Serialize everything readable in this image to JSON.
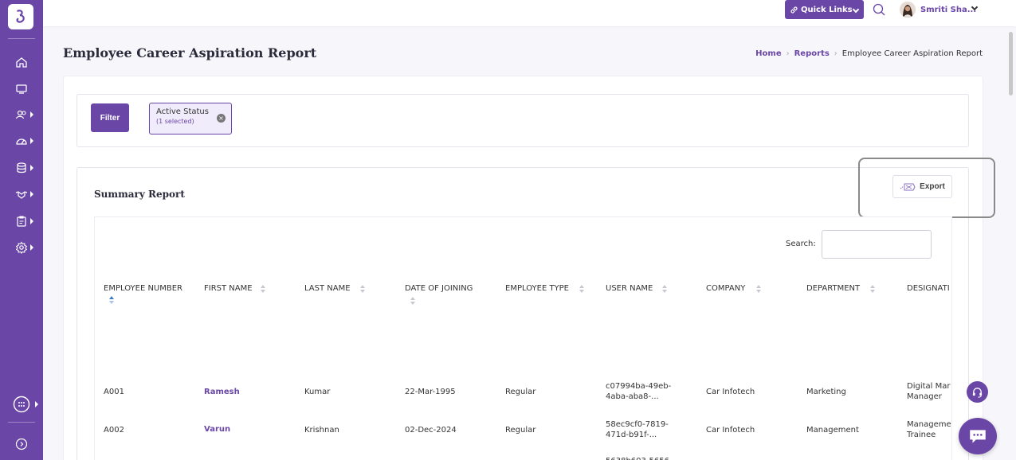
{
  "topbar": {
    "quick_links_label": "Quick Links",
    "user_name": "Smriti Sha..."
  },
  "header": {
    "title": "Employee Career Aspiration Report",
    "breadcrumb": [
      "Home",
      "Reports",
      "Employee Career Aspiration Report"
    ]
  },
  "filter": {
    "button_label": "Filter",
    "chip_title": "Active Status",
    "chip_sub": "(1 selected)"
  },
  "summary": {
    "title": "Summary Report",
    "export_label": "Export",
    "search_label": "Search:"
  },
  "table": {
    "columns": [
      "EMPLOYEE NUMBER",
      "FIRST NAME",
      "LAST NAME",
      "DATE OF JOINING",
      "EMPLOYEE TYPE",
      "USER NAME",
      "COMPANY",
      "DEPARTMENT",
      "DESIGNATI"
    ],
    "rows": [
      [
        "A001",
        "Ramesh",
        "Kumar",
        "22-Mar-1995",
        "Regular",
        "c07994ba-49eb-4aba-aba8-...",
        "Car Infotech",
        "Marketing",
        "Digital Mar Manager"
      ],
      [
        "A002",
        "Varun",
        "Krishnan",
        "02-Dec-2024",
        "Regular",
        "58ec9cf0-7819-471d-b91f-...",
        "Car Infotech",
        "Management",
        "Manageme Trainee"
      ]
    ],
    "partial_row_user": "5638b603-5656"
  },
  "sidebar": {
    "icons": [
      "home-icon",
      "monitor-icon",
      "users-icon",
      "dashboard-icon",
      "database-icon",
      "handshake-icon",
      "clipboard-icon",
      "settings-icon",
      "apps-icon",
      "collapse-icon"
    ]
  },
  "colors": {
    "brand": "#6a46a6"
  }
}
